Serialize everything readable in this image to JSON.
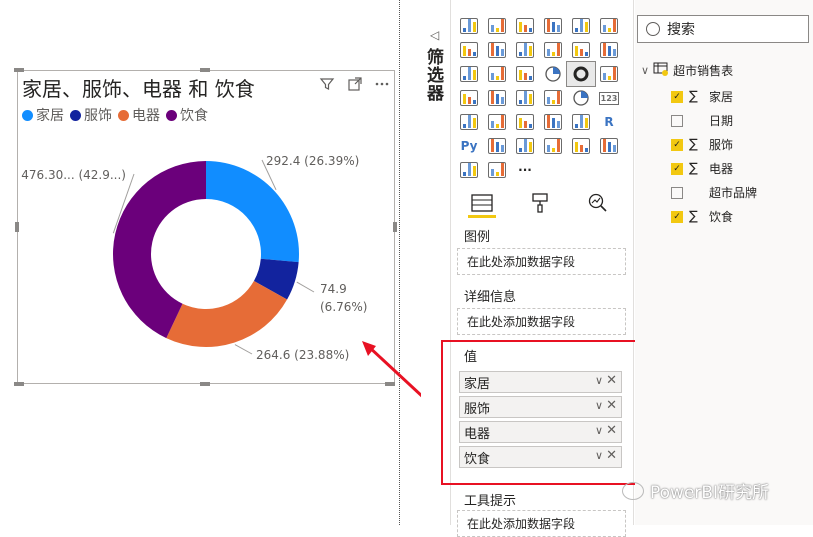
{
  "visual": {
    "title": "家居、服饰、电器 和 饮食",
    "icons": [
      "filter-icon",
      "focus-mode-icon",
      "more-options-icon"
    ]
  },
  "chart_data": {
    "type": "pie",
    "style": "donut",
    "title": "家居、服饰、电器 和 饮食",
    "legend_position": "top-left",
    "legend": [
      "家居",
      "服饰",
      "电器",
      "饮食"
    ],
    "series": [
      {
        "name": "家居",
        "value": 292.4,
        "label": "292.4 (26.39%)",
        "color": "#118dff"
      },
      {
        "name": "服饰",
        "value": 74.9,
        "label": "74.9 (6.76%)",
        "label_line1": "74.9",
        "label_line2": "(6.76%)",
        "color": "#12239e"
      },
      {
        "name": "电器",
        "value": 264.6,
        "label": "264.6 (23.88%)",
        "color": "#e66c37"
      },
      {
        "name": "饮食",
        "value": 476.3,
        "label": "476.30... (42.9...)",
        "color": "#6b007b"
      }
    ]
  },
  "filters_pane": {
    "collapse_icon": "collapse-left-icon",
    "label": "筛选器"
  },
  "viz_pane": {
    "icons": [
      "stacked-bar-icon",
      "stacked-column-icon",
      "clustered-bar-icon",
      "clustered-column-icon",
      "100-stacked-bar-icon",
      "100-stacked-column-icon",
      "line-chart-icon",
      "area-chart-icon",
      "stacked-area-icon",
      "line-column-icon",
      "line-clustered-column-icon",
      "ribbon-chart-icon",
      "waterfall-icon",
      "funnel-icon",
      "scatter-icon",
      "pie-chart-icon",
      "donut-chart-icon",
      "treemap-icon",
      "map-icon",
      "filled-map-icon",
      "shape-map-icon",
      "azure-map-icon",
      "gauge-icon",
      "card-icon",
      "multi-row-card-icon",
      "kpi-icon",
      "slicer-icon",
      "table-icon",
      "matrix-icon",
      "r-visual-icon",
      "python-visual-icon",
      "key-influencers-icon",
      "decomposition-tree-icon",
      "qa-icon",
      "paginated-report-icon",
      "more-visuals-icon",
      "power-apps-icon",
      "power-automate-icon",
      "ellipsis-icon"
    ],
    "selected_icon": "donut-chart-icon",
    "r_label": "R",
    "py_label": "Py",
    "num_label": "123",
    "ellipsis_label": "···",
    "tabs": [
      "fields-tab-icon",
      "format-tab-icon",
      "analytics-tab-icon"
    ],
    "legend_label": "图例",
    "legend_placeholder": "在此处添加数据字段",
    "details_label": "详细信息",
    "details_placeholder": "在此处添加数据字段",
    "values_label": "值",
    "values": [
      "家居",
      "服饰",
      "电器",
      "饮食"
    ],
    "tooltip_label": "工具提示",
    "tooltip_placeholder": "在此处添加数据字段"
  },
  "fields_pane": {
    "search_placeholder": "搜索",
    "table_name": "超市销售表",
    "fields": [
      {
        "name": "家居",
        "checked": true,
        "sigma": true
      },
      {
        "name": "日期",
        "checked": false,
        "sigma": false
      },
      {
        "name": "服饰",
        "checked": true,
        "sigma": true
      },
      {
        "name": "电器",
        "checked": true,
        "sigma": true
      },
      {
        "name": "超市品牌",
        "checked": false,
        "sigma": false
      },
      {
        "name": "饮食",
        "checked": true,
        "sigma": true
      }
    ]
  },
  "watermark": "PowerBI研究所",
  "annotation_color": "#e81123"
}
